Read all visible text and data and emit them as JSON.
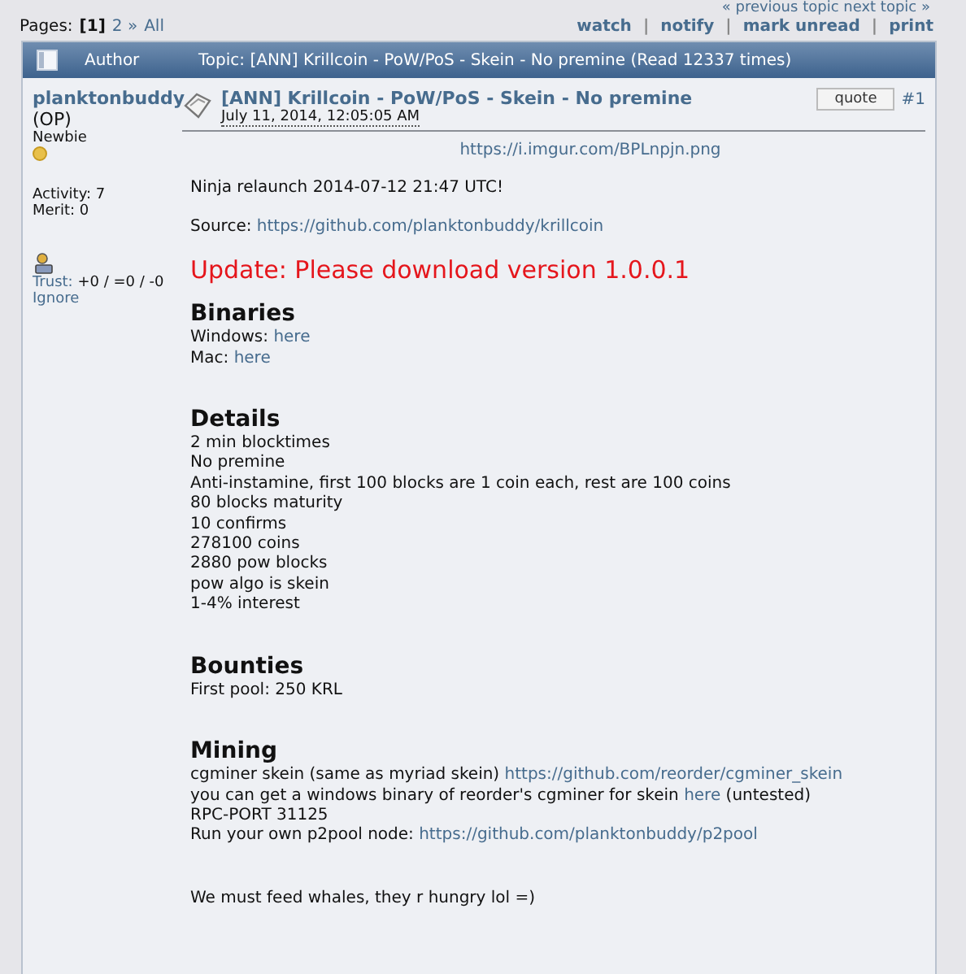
{
  "topic_nav": "« previous topic next topic »",
  "pages": {
    "label": "Pages:",
    "current": "[1]",
    "links": [
      "2 »",
      "All"
    ]
  },
  "actions": [
    "watch",
    "notify",
    "mark unread",
    "print"
  ],
  "action_separator": "|",
  "header": {
    "author": "Author",
    "topic": "Topic: [ANN] Krillcoin - PoW/PoS - Skein - No premine  (Read 12337 times)"
  },
  "author": {
    "name": "planktonbuddy",
    "tag": "(OP)",
    "rank": "Newbie",
    "activity": "Activity: 7",
    "merit": "Merit: 0",
    "trust_label": "Trust:",
    "trust_value": "+0 / =0 / -0",
    "ignore": "Ignore"
  },
  "post": {
    "title": "[ANN] Krillcoin - PoW/PoS - Skein - No premine",
    "date": "July 11, 2014, 12:05:05 AM",
    "quote": "quote",
    "number": "#1"
  },
  "body": [
    {
      "kind": "center_link",
      "lines": [
        [
          {
            "text": "https://i.imgur.com/BPLnpjn.png",
            "kind": "link"
          }
        ]
      ]
    },
    {
      "kind": "text",
      "lines": [
        [
          {
            "text": "Ninja relaunch 2014-07-12 21:47 UTC!",
            "kind": "text"
          }
        ]
      ]
    },
    {
      "kind": "text",
      "lines": [
        [
          {
            "text": "Source: ",
            "kind": "text"
          },
          {
            "text": "https://github.com/planktonbuddy/krillcoin",
            "kind": "link"
          }
        ]
      ]
    },
    {
      "kind": "notice",
      "lines": [
        [
          {
            "text": "Update: Please download version 1.0.0.1",
            "kind": "text"
          }
        ]
      ]
    },
    {
      "kind": "heading",
      "lines": [
        [
          {
            "text": "Binaries",
            "kind": "text"
          }
        ]
      ]
    },
    {
      "kind": "list",
      "lines": [
        [
          {
            "text": "Windows: ",
            "kind": "text"
          },
          {
            "text": "here",
            "kind": "link"
          }
        ],
        [
          {
            "text": "Mac: ",
            "kind": "text"
          },
          {
            "text": "here",
            "kind": "link"
          }
        ]
      ]
    },
    {
      "kind": "heading",
      "lines": [
        [
          {
            "text": "Details",
            "kind": "text"
          }
        ]
      ]
    },
    {
      "kind": "list",
      "lines": [
        [
          {
            "text": "2 min blocktimes",
            "kind": "text"
          }
        ],
        [
          {
            "text": "No premine",
            "kind": "text"
          }
        ],
        [
          {
            "text": "Anti-instamine, first 100 blocks are 1 coin each, rest are 100 coins",
            "kind": "text"
          }
        ],
        [
          {
            "text": "80 blocks maturity",
            "kind": "text"
          }
        ],
        [
          {
            "text": "10 confirms",
            "kind": "text"
          }
        ],
        [
          {
            "text": "278100 coins",
            "kind": "text"
          }
        ],
        [
          {
            "text": "2880 pow blocks",
            "kind": "text"
          }
        ],
        [
          {
            "text": "pow algo is skein",
            "kind": "text"
          }
        ],
        [
          {
            "text": "1-4% interest",
            "kind": "text"
          }
        ]
      ]
    },
    {
      "kind": "heading",
      "lines": [
        [
          {
            "text": "Bounties",
            "kind": "text"
          }
        ]
      ]
    },
    {
      "kind": "list",
      "lines": [
        [
          {
            "text": "First pool: 250 KRL",
            "kind": "text"
          }
        ]
      ]
    },
    {
      "kind": "heading",
      "lines": [
        [
          {
            "text": "Mining",
            "kind": "text"
          }
        ]
      ]
    },
    {
      "kind": "list",
      "lines": [
        [
          {
            "text": "cgminer skein (same as myriad skein) ",
            "kind": "text"
          },
          {
            "text": "https://github.com/reorder/cgminer_skein",
            "kind": "link"
          }
        ],
        [
          {
            "text": "you can get a windows binary of reorder's cgminer for skein ",
            "kind": "text"
          },
          {
            "text": "here",
            "kind": "link"
          },
          {
            "text": " (untested)",
            "kind": "text"
          }
        ],
        [
          {
            "text": "RPC-PORT 31125",
            "kind": "text"
          }
        ],
        [
          {
            "text": "Run your own p2pool node: ",
            "kind": "text"
          },
          {
            "text": "https://github.com/planktonbuddy/p2pool",
            "kind": "link"
          }
        ]
      ]
    },
    {
      "kind": "closing",
      "lines": [
        [
          {
            "text": "We must feed whales, they r hungry lol =)",
            "kind": "text"
          }
        ]
      ]
    }
  ]
}
